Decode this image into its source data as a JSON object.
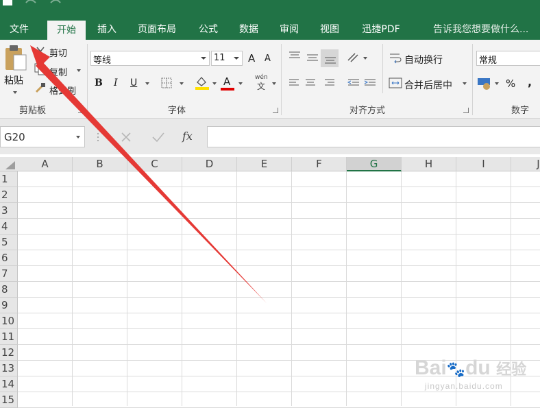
{
  "colors": {
    "accent": "#217346",
    "arrow": "#e53935"
  },
  "tabs": [
    {
      "label": "文件",
      "active": false
    },
    {
      "label": "开始",
      "active": true
    },
    {
      "label": "插入",
      "active": false
    },
    {
      "label": "页面布局",
      "active": false
    },
    {
      "label": "公式",
      "active": false
    },
    {
      "label": "数据",
      "active": false
    },
    {
      "label": "审阅",
      "active": false
    },
    {
      "label": "视图",
      "active": false
    },
    {
      "label": "迅捷PDF",
      "active": false
    }
  ],
  "tell_me": "告诉我您想要做什么...",
  "clipboard": {
    "paste": "粘贴",
    "cut": "剪切",
    "copy": "复制",
    "format_painter": "格式刷",
    "group": "剪贴板"
  },
  "font": {
    "name": "等线",
    "size": "11",
    "group": "字体",
    "bold": "B",
    "italic": "I",
    "underline": "U",
    "grow": "A",
    "shrink": "A",
    "phonetic_top": "wén",
    "phonetic_bottom": "文",
    "font_color": "A"
  },
  "alignment": {
    "wrap_text": "自动换行",
    "merge_center": "合并后居中",
    "group": "对齐方式"
  },
  "number": {
    "format": "常规",
    "percent": "%",
    "comma": ",",
    "group": "数字"
  },
  "formula_bar": {
    "name_box": "G20",
    "fx": "fx",
    "value": ""
  },
  "columns": [
    "A",
    "B",
    "C",
    "D",
    "E",
    "F",
    "G",
    "H",
    "I",
    "J"
  ],
  "selected_column": "G",
  "rows": [
    "1",
    "2",
    "3",
    "4",
    "5",
    "6",
    "7",
    "8",
    "9",
    "10",
    "11",
    "12",
    "13",
    "14",
    "15"
  ],
  "watermark": {
    "brand": "Bai",
    "brand2": "du",
    "cn": "经验",
    "url": "jingyan.baidu.com"
  }
}
